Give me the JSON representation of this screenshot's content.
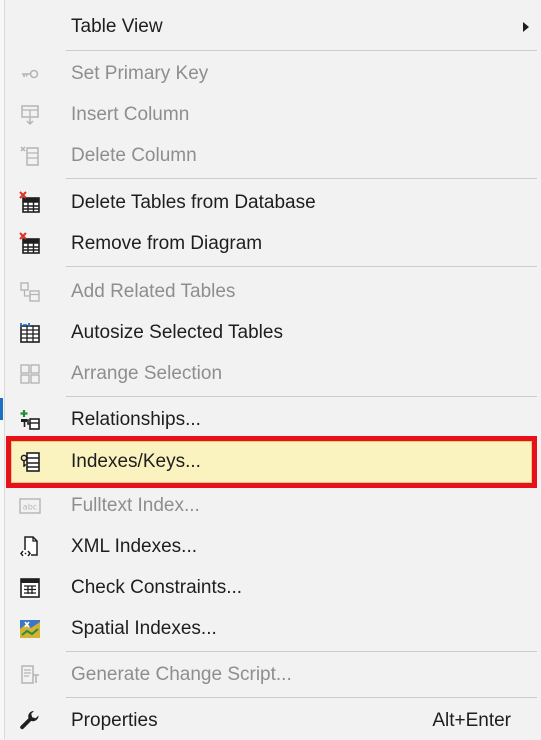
{
  "menu": {
    "items": [
      {
        "label": "Table View",
        "disabled": false,
        "submenu": true,
        "icon": "none"
      },
      {
        "label": "Set Primary Key",
        "disabled": true,
        "icon": "key-icon"
      },
      {
        "label": "Insert Column",
        "disabled": true,
        "icon": "insert-column-icon"
      },
      {
        "label": "Delete Column",
        "disabled": true,
        "icon": "delete-column-icon"
      },
      {
        "label": "Delete Tables from Database",
        "disabled": false,
        "icon": "delete-table-icon"
      },
      {
        "label": "Remove from Diagram",
        "disabled": false,
        "icon": "remove-table-icon"
      },
      {
        "label": "Add Related Tables",
        "disabled": true,
        "icon": "add-related-tables-icon"
      },
      {
        "label": "Autosize Selected Tables",
        "disabled": false,
        "icon": "autosize-table-icon"
      },
      {
        "label": "Arrange Selection",
        "disabled": true,
        "icon": "arrange-selection-icon"
      },
      {
        "label": "Relationships...",
        "disabled": false,
        "icon": "relationships-icon"
      },
      {
        "label": "Indexes/Keys...",
        "disabled": false,
        "highlighted": true,
        "icon": "indexes-keys-icon"
      },
      {
        "label": "Fulltext Index...",
        "disabled": true,
        "icon": "fulltext-index-icon"
      },
      {
        "label": "XML Indexes...",
        "disabled": false,
        "icon": "xml-indexes-icon"
      },
      {
        "label": "Check Constraints...",
        "disabled": false,
        "icon": "check-constraints-icon"
      },
      {
        "label": "Spatial Indexes...",
        "disabled": false,
        "icon": "spatial-indexes-icon"
      },
      {
        "label": "Generate Change Script...",
        "disabled": true,
        "icon": "generate-script-icon"
      },
      {
        "label": "Properties",
        "disabled": false,
        "icon": "wrench-icon",
        "shortcut": "Alt+Enter"
      }
    ]
  },
  "colors": {
    "menu_background": "#f2f2f2",
    "highlight_fill": "#fbf3bf",
    "highlight_border": "#e8101a",
    "disabled_text": "#8e8e8e",
    "text": "#1e1e1e"
  }
}
